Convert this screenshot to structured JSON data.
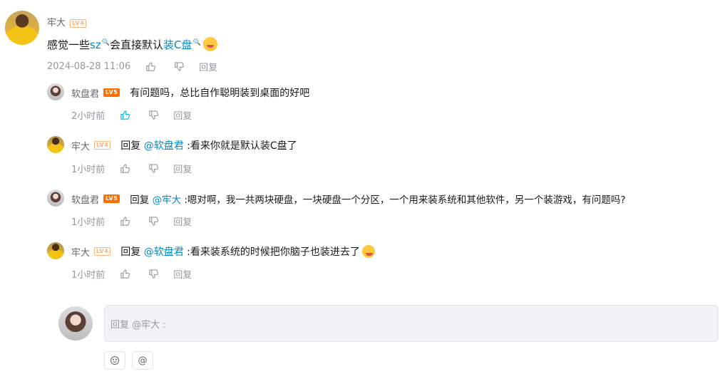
{
  "main_comment": {
    "username": "牢大",
    "level": "LV4",
    "content_parts": [
      "感觉一些",
      "sz",
      "会直接默认",
      "装C盘"
    ],
    "search_glyph": "🔍",
    "emoji": "grin-emoji",
    "time": "2024-08-28 11:06",
    "reply_label": "回复"
  },
  "replies": [
    {
      "username": "软盘君",
      "level": "LV5",
      "prefix": "",
      "mention": "",
      "text": "有问题吗，总比自作聪明装到桌面的好吧",
      "time": "2小时前",
      "liked": true,
      "reply_label": "回复"
    },
    {
      "username": "牢大",
      "level": "LV4",
      "prefix": "回复 ",
      "mention": "@软盘君",
      "text": " :看来你就是默认装C盘了",
      "time": "1小时前",
      "liked": false,
      "reply_label": "回复"
    },
    {
      "username": "软盘君",
      "level": "LV5",
      "prefix": "回复 ",
      "mention": "@牢大",
      "text": " :嗯对啊，我一共两块硬盘，一块硬盘一个分区，一个用来装系统和其他软件，另一个装游戏，有问题吗?",
      "time": "1小时前",
      "liked": false,
      "reply_label": "回复"
    },
    {
      "username": "牢大",
      "level": "LV4",
      "prefix": "回复 ",
      "mention": "@软盘君",
      "text": " :看来装系统的时候把你脑子也装进去了",
      "time": "1小时前",
      "liked": false,
      "reply_label": "回复"
    }
  ],
  "reply_box": {
    "placeholder": "回复 @牢大 :"
  },
  "toolbar": {
    "emoji_label": "☺",
    "at_label": "@"
  },
  "colors": {
    "link": "#008ac5",
    "meta": "#9499a0",
    "liked": "#00aeec"
  }
}
